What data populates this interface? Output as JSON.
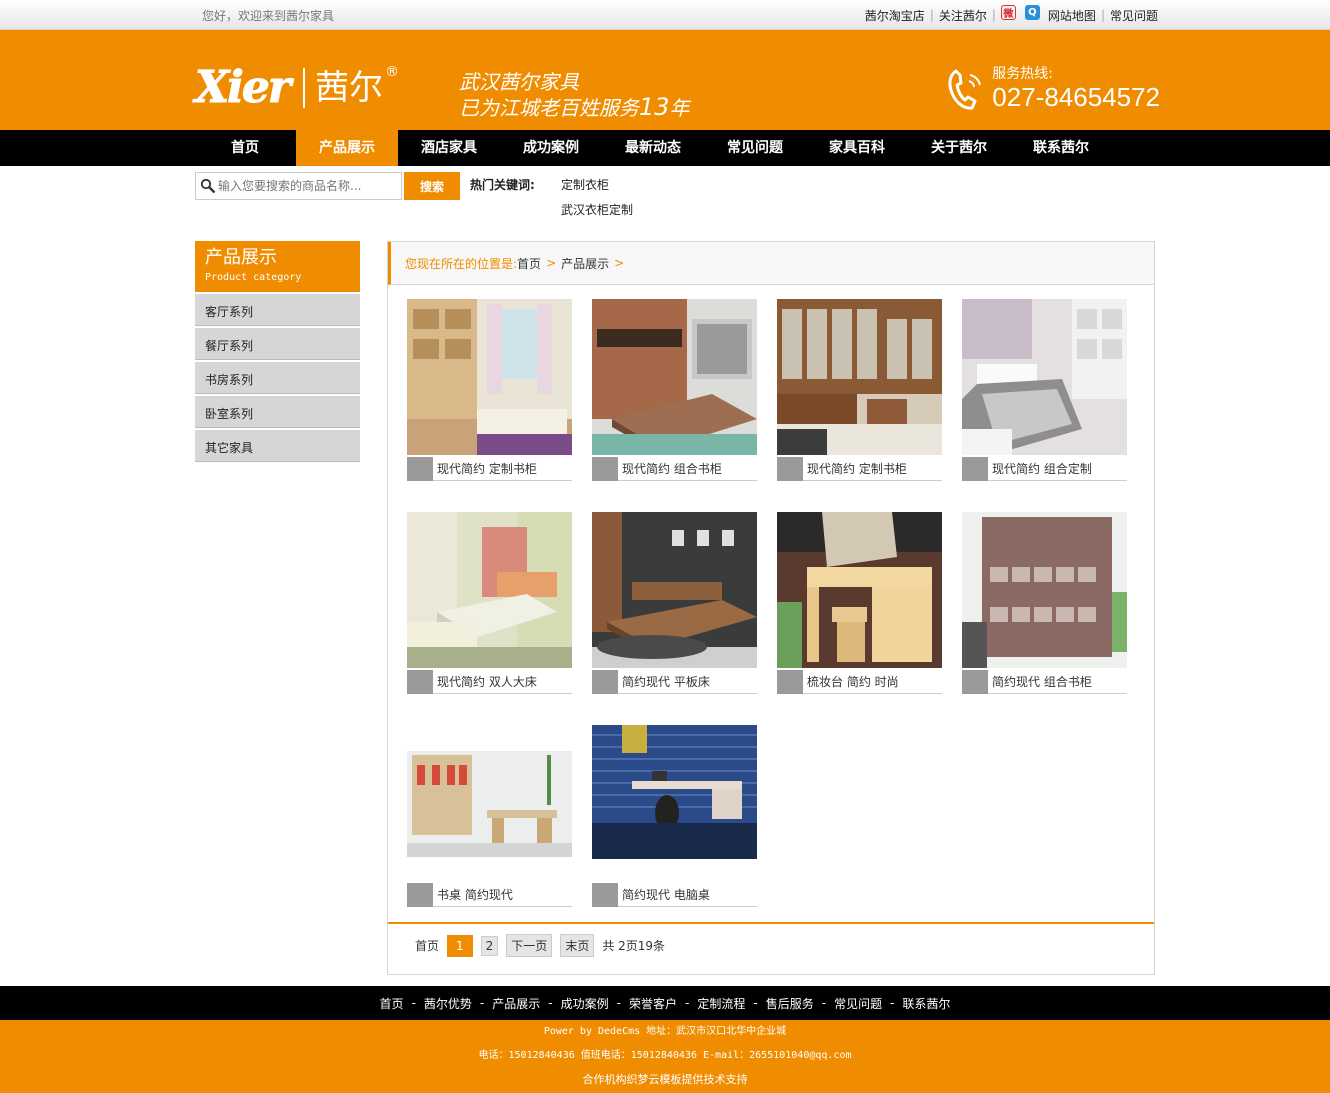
{
  "topbar": {
    "welcome": "您好，欢迎来到茜尔家具",
    "links": [
      "茜尔淘宝店",
      "关注茜尔",
      "网站地图",
      "常见问题"
    ]
  },
  "header": {
    "logo_en": "Xier",
    "logo_cn": "茜尔",
    "logo_reg": "®",
    "slogan_line1": "武汉茜尔家具",
    "slogan_line2_prefix": "已为江城老百姓服务",
    "slogan_years": "13",
    "slogan_line2_suffix": "年",
    "hotline_label": "服务热线:",
    "hotline_number": "027-84654572"
  },
  "nav": {
    "items": [
      "首页",
      "产品展示",
      "酒店家具",
      "成功案例",
      "最新动态",
      "常见问题",
      "家具百科",
      "关于茜尔",
      "联系茜尔"
    ],
    "active_index": 1
  },
  "search": {
    "placeholder": "输入您要搜索的商品名称...",
    "button_label": "搜索",
    "hot_label": "热门关键词:",
    "hot_keywords": [
      "定制衣柜",
      "武汉衣柜定制"
    ]
  },
  "sidebar": {
    "title": "产品展示",
    "subtitle": "Product category",
    "items": [
      "客厅系列",
      "餐厅系列",
      "书房系列",
      "卧室系列",
      "其它家具"
    ]
  },
  "breadcrumb": {
    "label": "您现在所在的位置是:",
    "items": [
      "首页",
      "产品展示"
    ]
  },
  "products": [
    {
      "title": "现代简约 定制书柜"
    },
    {
      "title": "现代简约 组合书柜"
    },
    {
      "title": "现代简约 定制书柜"
    },
    {
      "title": "现代简约 组合定制"
    },
    {
      "title": "现代简约 双人大床"
    },
    {
      "title": "简约现代 平板床"
    },
    {
      "title": "梳妆台 简约 时尚"
    },
    {
      "title": "简约现代 组合书柜"
    },
    {
      "title": "书桌 简约现代"
    },
    {
      "title": "简约现代 电脑桌"
    }
  ],
  "pager": {
    "first": "首页",
    "pages": [
      "1",
      "2"
    ],
    "current": "1",
    "next": "下一页",
    "last": "末页",
    "summary": "共 2页19条"
  },
  "footer": {
    "nav": [
      "首页",
      "茜尔优势",
      "产品展示",
      "成功案例",
      "荣誉客户",
      "定制流程",
      "售后服务",
      "常见问题",
      "联系茜尔"
    ],
    "line1": "Power by DedeCms 地址：武汉市汉口北华中企业城",
    "line2": "电话：15012840436 值班电话：15012840436 E-mail：2655101040@qq.com",
    "line3": "合作机构织梦云模板提供技术支持"
  },
  "colors": {
    "brand_orange": "#ef8c00",
    "nav_black": "#000000",
    "sidebar_gray": "#d6d6d6"
  }
}
